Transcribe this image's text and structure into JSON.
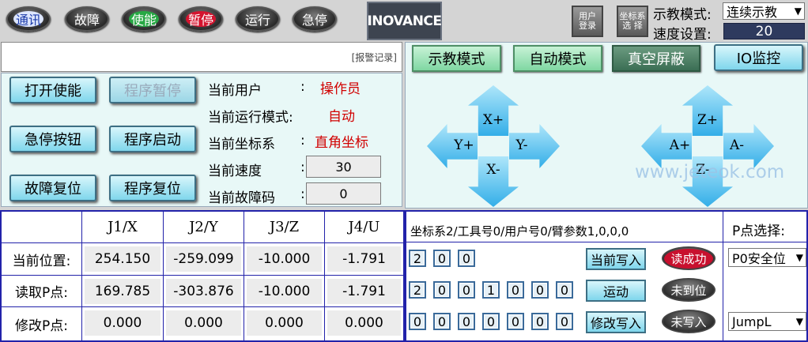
{
  "topbar": {
    "buttons": [
      {
        "label": "通讯",
        "color": "#e8f0ff",
        "bg": "#3b62c8"
      },
      {
        "label": "故障",
        "color": "#ffffff",
        "bg": "#555555"
      },
      {
        "label": "使能",
        "color": "#ffffff",
        "bg": "#1e9e3a"
      },
      {
        "label": "暂停",
        "color": "#ffffff",
        "bg": "#c8102e"
      },
      {
        "label": "运行",
        "color": "#ffffff",
        "bg": "#4a4a4a"
      },
      {
        "label": "急停",
        "color": "#ffffff",
        "bg": "#4a4a4a"
      }
    ],
    "logo": "INOVANCE",
    "user_login": "用户\n登录",
    "coord_select": "坐标系\n选 择",
    "teach_mode_label": "示教模式:",
    "teach_mode_value": "连续示教",
    "speed_label": "速度设置:",
    "speed_value": "20"
  },
  "alarm": {
    "link": "[报警记录]"
  },
  "controls": {
    "open_enable": "打开使能",
    "program_pause": "程序暂停",
    "estop_button": "急停按钮",
    "program_start": "程序启动",
    "fault_reset": "故障复位",
    "program_reset": "程序复位"
  },
  "status": {
    "user_label": "当前用户",
    "user_colon": ":",
    "user_value": "操作员",
    "mode_label": "当前运行模式:",
    "mode_value": "自动",
    "coord_label": "当前坐标系",
    "coord_colon": ":",
    "coord_value": "直角坐标",
    "speed_label": "当前速度",
    "speed_colon": ":",
    "speed_value": "30",
    "fault_label": "当前故障码",
    "fault_colon": ":",
    "fault_value": "0"
  },
  "mode_buttons": {
    "teach": "示教模式",
    "auto": "自动模式",
    "vacuum": "真空屏蔽",
    "io": "IO监控"
  },
  "jog": {
    "x_plus": "X+",
    "x_minus": "X-",
    "y_plus": "Y+",
    "y_minus": "Y-",
    "z_plus": "Z+",
    "z_minus": "Z-",
    "a_plus": "A+",
    "a_minus": "A-"
  },
  "watermark": "www.jeteok.com",
  "table": {
    "headers": [
      "J1/X",
      "J2/Y",
      "J3/Z",
      "J4/U"
    ],
    "rows": [
      {
        "label": "当前位置:",
        "values": [
          "254.150",
          "-259.099",
          "-10.000",
          "-1.791"
        ]
      },
      {
        "label": "读取P点:",
        "values": [
          "169.785",
          "-303.876",
          "-10.000",
          "-1.791"
        ]
      },
      {
        "label": "修改P点:",
        "values": [
          "0.000",
          "0.000",
          "0.000",
          "0.000"
        ]
      }
    ]
  },
  "point_panel": {
    "info": "坐标系2/工具号0/用户号0/臂参数1,0,0,0",
    "row1_digits": [
      "2",
      "0",
      "0"
    ],
    "row2_digits": [
      "2",
      "0",
      "0",
      "1",
      "0",
      "0",
      "0"
    ],
    "row3_digits": [
      "0",
      "0",
      "0",
      "0",
      "0",
      "0",
      "0"
    ],
    "write_current": "当前写入",
    "move": "运动",
    "modify_write": "修改写入",
    "read_ok": "读成功",
    "not_arrived": "未到位",
    "not_written": "未写入",
    "p_select_label": "P点选择:",
    "p_select_value": "P0安全位",
    "jump_value": "JumpL"
  }
}
